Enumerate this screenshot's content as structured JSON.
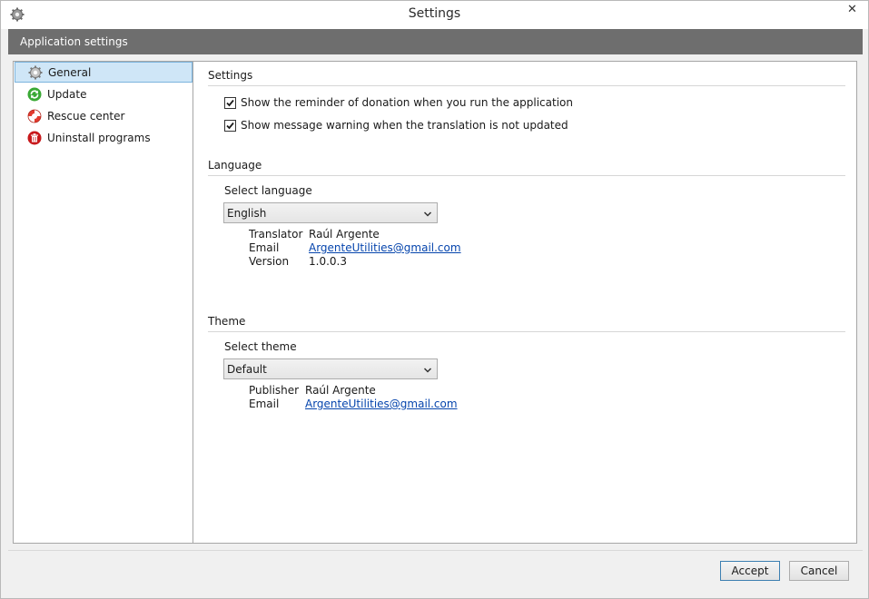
{
  "window": {
    "title": "Settings",
    "close_glyph": "✕"
  },
  "header": {
    "title": "Application settings"
  },
  "sidebar": {
    "items": [
      {
        "label": "General",
        "icon": "gear-icon",
        "selected": true
      },
      {
        "label": "Update",
        "icon": "update-icon",
        "selected": false
      },
      {
        "label": "Rescue center",
        "icon": "lifebuoy-icon",
        "selected": false
      },
      {
        "label": "Uninstall programs",
        "icon": "uninstall-icon",
        "selected": false
      }
    ]
  },
  "settings_section": {
    "title": "Settings",
    "options": [
      {
        "label": "Show the reminder of donation when you run the application",
        "checked": true
      },
      {
        "label": "Show message warning when the translation is not updated",
        "checked": true
      }
    ]
  },
  "language_section": {
    "title": "Language",
    "select_label": "Select language",
    "selected_value": "English",
    "info": {
      "translator_key": "Translator",
      "translator_value": "Raúl Argente",
      "email_key": "Email",
      "email_value": "ArgenteUtilities@gmail.com",
      "version_key": "Version",
      "version_value": "1.0.0.3"
    }
  },
  "theme_section": {
    "title": "Theme",
    "select_label": "Select theme",
    "selected_value": "Default",
    "info": {
      "publisher_key": "Publisher",
      "publisher_value": "Raúl Argente",
      "email_key": "Email",
      "email_value": "ArgenteUtilities@gmail.com"
    }
  },
  "footer": {
    "accept_label": "Accept",
    "cancel_label": "Cancel"
  },
  "colors": {
    "header_band": "#6e6e6e",
    "selection_bg": "#cfe6f7",
    "selection_border": "#7cb4de",
    "link": "#0645ad"
  }
}
